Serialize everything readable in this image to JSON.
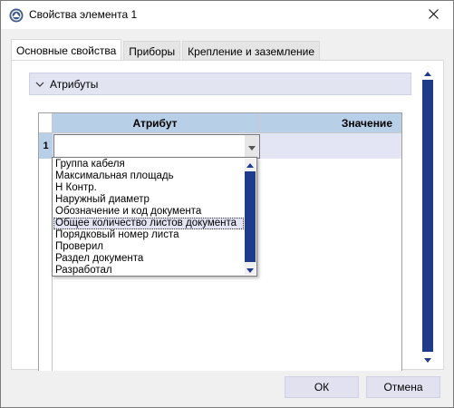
{
  "window": {
    "title": "Свойства элемента 1"
  },
  "tabs": [
    {
      "label": "Основные свойства",
      "active": true
    },
    {
      "label": "Приборы",
      "active": false
    },
    {
      "label": "Крепление и заземление",
      "active": false
    }
  ],
  "section": {
    "title": "Атрибуты",
    "expanded": true
  },
  "grid": {
    "columns": [
      "Атрибут",
      "Значение"
    ],
    "rows": [
      {
        "number": "1",
        "attribute": "",
        "value": ""
      }
    ]
  },
  "dropdown": {
    "options": [
      "Группа кабеля",
      "Максимальная площадь",
      "Н Контр.",
      "Наружный диаметр",
      "Обозначение и код документа",
      "Общее количество листов документа",
      "Порядковый номер листа",
      "Проверил",
      "Раздел документа",
      "Разработал"
    ],
    "highlighted_index": 5
  },
  "buttons": {
    "ok": "ОК",
    "cancel": "Отмена"
  },
  "colors": {
    "grid_header": "#b8cfe8",
    "row_selected": "#e3e5f4",
    "scroll_thumb": "#1f3b8c",
    "button_bg": "#e1e1f0"
  },
  "icons": {
    "app": "app-logo-icon",
    "close": "close-icon",
    "section": "chevron-down-icon"
  }
}
